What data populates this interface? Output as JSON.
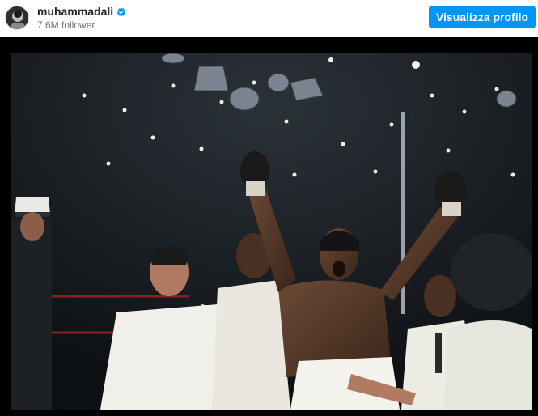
{
  "header": {
    "username": "muhammadali",
    "followers": "7.6M follower",
    "profile_button_label": "Visualizza profilo",
    "verified_icon": "verified-badge-icon"
  },
  "media": {
    "type": "photo"
  },
  "colors": {
    "brand_blue": "#0095f6",
    "text_primary": "#262626",
    "text_secondary": "#737373",
    "media_background": "#000000"
  }
}
